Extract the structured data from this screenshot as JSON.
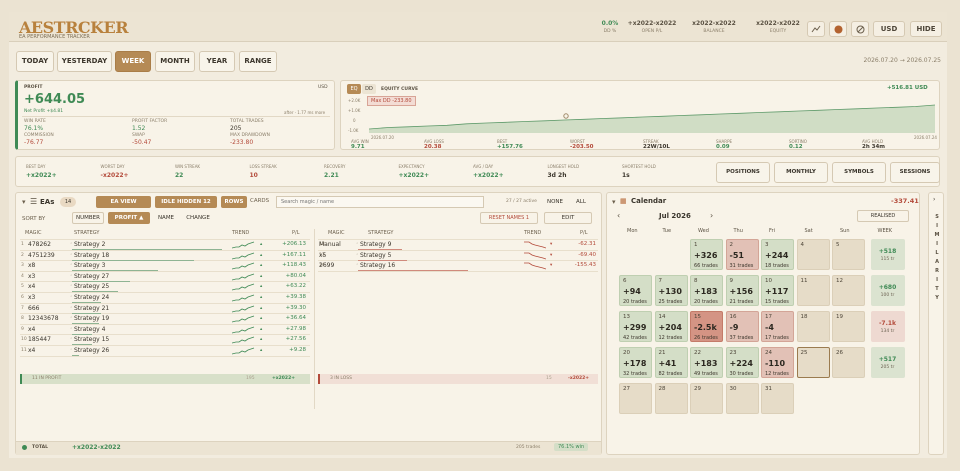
{
  "header": {
    "logo": "AESTRCKER",
    "subtitle": "EA PERFORMANCE TRACKER",
    "dd_pct": "0.0%",
    "dd_label": "DD %",
    "open_pl": "+x2022-x2022",
    "open_pl_label": "OPEN P/L",
    "balance": "x2022-x2022",
    "balance_label": "BALANCE",
    "equity": "x2022-x2022",
    "equity_label": "EQUITY",
    "currency_btn": "USD",
    "hide_btn": "HIDE"
  },
  "tabs": [
    "TODAY",
    "YESTERDAY",
    "WEEK",
    "MONTH",
    "YEAR",
    "RANGE"
  ],
  "active_tab": "WEEK",
  "date_range": "2026.07.20 → 2026.07.25",
  "profit_card": {
    "label": "PROFIT",
    "currency": "USD",
    "value": "+644.05",
    "net": "Net Profit +$4.81",
    "updated": "after · 1.77 ms more",
    "win_rate_label": "WIN RATE",
    "win_rate": "76.1%",
    "pf_label": "PROFIT FACTOR",
    "pf": "1.52",
    "trades_label": "TOTAL TRADES",
    "trades": "205",
    "comm_label": "COMMISSION",
    "comm": "-76.77",
    "swap_label": "SWAP",
    "swap": "-50.47",
    "mdd_label": "MAX DRAWDOWN",
    "mdd": "-233.80"
  },
  "equity": {
    "tab1": "EQ",
    "tab2": "DD",
    "title": "EQUITY CURVE",
    "maxdd": "Max DD -233.80",
    "total": "+516.81 USD",
    "y_ticks": [
      "+2.0K",
      "+1.0K",
      "0",
      "-1.0K"
    ],
    "x_start": "2026.07.20",
    "x_end": "2026.07.24",
    "curve": [
      0,
      2,
      3,
      4,
      5,
      7,
      8,
      9,
      10,
      11,
      12,
      13,
      14,
      15,
      16,
      17,
      18,
      19,
      20,
      21,
      22,
      23,
      24,
      25,
      26,
      27,
      28,
      29,
      30,
      32
    ],
    "metrics": [
      {
        "label": "AVG WIN",
        "value": "9.71",
        "color": "green"
      },
      {
        "label": "AVG LOSS",
        "value": "20.38",
        "color": "red"
      },
      {
        "label": "BEST",
        "value": "+157.76",
        "color": "green"
      },
      {
        "label": "WORST",
        "value": "-203.50",
        "color": "red"
      },
      {
        "label": "STREAK",
        "value": "22W/10L",
        "color": "dark"
      },
      {
        "label": "SHARPE",
        "value": "0.09",
        "color": "green"
      },
      {
        "label": "SORTINO",
        "value": "0.12",
        "color": "green"
      },
      {
        "label": "AVG HOLD",
        "value": "2h 34m",
        "color": "dark"
      }
    ]
  },
  "stats_row": [
    {
      "label": "BEST DAY",
      "value": "+x2022+",
      "color": "green"
    },
    {
      "label": "WORST DAY",
      "value": "-x2022+",
      "color": "red"
    },
    {
      "label": "WIN STREAK",
      "value": "22",
      "color": "green"
    },
    {
      "label": "LOSS STREAK",
      "value": "10",
      "color": "red"
    },
    {
      "label": "RECOVERY",
      "value": "2.21",
      "color": "green"
    },
    {
      "label": "EXPECTANCY",
      "value": "+x2022+",
      "color": "green"
    },
    {
      "label": "AVG / DAY",
      "value": "+x2022+",
      "color": "green"
    },
    {
      "label": "LONGEST HOLD",
      "value": "3d 2h",
      "color": "dark"
    },
    {
      "label": "SHORTEST HOLD",
      "value": "1s",
      "color": "dark"
    }
  ],
  "stats_buttons": [
    "POSITIONS",
    "MONTHLY",
    "SYMBOLS",
    "SESSIONS"
  ],
  "eas": {
    "title": "EAs",
    "count": "14",
    "btn_view": "EA VIEW",
    "btn_idle": "IDLE HIDDEN 12",
    "btn_rows": "ROWS",
    "btn_cards": "CARDS",
    "search_placeholder": "Search magic / name",
    "active": "27 / 27 active",
    "btn_none": "NONE",
    "btn_all": "ALL",
    "sort_label": "SORT BY",
    "sort": [
      "NUMBER",
      "PROFIT ▲",
      "NAME",
      "CHANGE"
    ],
    "reset_names": "RESET NAMES 1",
    "edit": "EDIT",
    "col_magic": "MAGIC",
    "col_strategy": "STRATEGY",
    "col_trend": "TREND",
    "col_pl": "P/L",
    "left_rows": [
      {
        "n": "1",
        "magic": "478262",
        "name": "Strategy 2",
        "pl": "+206.13"
      },
      {
        "n": "2",
        "magic": "4751239",
        "name": "Strategy 18",
        "pl": "+167.11"
      },
      {
        "n": "3",
        "magic": "x8",
        "name": "Strategy 3",
        "pl": "+118.43"
      },
      {
        "n": "4",
        "magic": "x3",
        "name": "Strategy 27",
        "pl": "+80.04"
      },
      {
        "n": "5",
        "magic": "x4",
        "name": "Strategy 25",
        "pl": "+63.22"
      },
      {
        "n": "6",
        "magic": "x3",
        "name": "Strategy 24",
        "pl": "+39.38"
      },
      {
        "n": "7",
        "magic": "666",
        "name": "Strategy 21",
        "pl": "+39.30"
      },
      {
        "n": "8",
        "magic": "12343678",
        "name": "Strategy 19",
        "pl": "+36.64"
      },
      {
        "n": "9",
        "magic": "x4",
        "name": "Strategy 4",
        "pl": "+27.98"
      },
      {
        "n": "10",
        "magic": "185447",
        "name": "Strategy 15",
        "pl": "+27.56"
      },
      {
        "n": "11",
        "magic": "x4",
        "name": "Strategy 26",
        "pl": "+9.28"
      }
    ],
    "right_rows": [
      {
        "n": "12",
        "magic": "Manual",
        "name": "Strategy 9",
        "pl": "-62.31"
      },
      {
        "n": "13",
        "magic": "x5",
        "name": "Strategy 5",
        "pl": "-69.40"
      },
      {
        "n": "14",
        "magic": "2699",
        "name": "Strategy 16",
        "pl": "-155.43"
      }
    ],
    "footer_left": "11 IN PROFIT",
    "footer_left_n": "195",
    "footer_left_v": "+x2022+",
    "footer_right": "3 IN LOSS",
    "footer_right_n": "15",
    "footer_right_v": "-x2022+",
    "total_label": "TOTAL",
    "total_v": "+x2022-x2022",
    "total_trades": "205 trades",
    "total_win": "76.1% win"
  },
  "calendar": {
    "title": "Calendar",
    "total": "-337.41",
    "month": "Jul 2026",
    "realised": "REALISED",
    "days": [
      "Mon",
      "Tue",
      "Wed",
      "Thu",
      "Fri",
      "Sat",
      "Sun"
    ],
    "week_label": "WEEK",
    "rows": [
      [
        {
          "d": ""
        },
        {
          "d": ""
        },
        {
          "d": "1",
          "p": "+326",
          "t": "66 trades",
          "c": "g"
        },
        {
          "d": "2",
          "p": "-51",
          "t": "31 trades",
          "c": "r"
        },
        {
          "d": "3",
          "p": "+244",
          "t": "18 trades",
          "c": "g"
        },
        {
          "d": "4"
        },
        {
          "d": "5"
        }
      ],
      [
        {
          "d": "6",
          "p": "+94",
          "t": "20 trades",
          "c": "g"
        },
        {
          "d": "7",
          "p": "+130",
          "t": "25 trades",
          "c": "g"
        },
        {
          "d": "8",
          "p": "+183",
          "t": "20 trades",
          "c": "g"
        },
        {
          "d": "9",
          "p": "+156",
          "t": "21 trades",
          "c": "g"
        },
        {
          "d": "10",
          "p": "+117",
          "t": "15 trades",
          "c": "g"
        },
        {
          "d": "11"
        },
        {
          "d": "12"
        }
      ],
      [
        {
          "d": "13",
          "p": "+299",
          "t": "42 trades",
          "c": "g"
        },
        {
          "d": "14",
          "p": "+204",
          "t": "12 trades",
          "c": "g"
        },
        {
          "d": "15",
          "p": "-2.5k",
          "t": "26 trades",
          "c": "rr"
        },
        {
          "d": "16",
          "p": "-9",
          "t": "37 trades",
          "c": "r"
        },
        {
          "d": "17",
          "p": "-4",
          "t": "17 trades",
          "c": "r"
        },
        {
          "d": "18"
        },
        {
          "d": "19"
        }
      ],
      [
        {
          "d": "20",
          "p": "+178",
          "t": "32 trades",
          "c": "g"
        },
        {
          "d": "21",
          "p": "+41",
          "t": "82 trades",
          "c": "g"
        },
        {
          "d": "22",
          "p": "+183",
          "t": "49 trades",
          "c": "g"
        },
        {
          "d": "23",
          "p": "+224",
          "t": "30 trades",
          "c": "g"
        },
        {
          "d": "24",
          "p": "-110",
          "t": "12 trades",
          "c": "r"
        },
        {
          "d": "25",
          "c": "sel"
        },
        {
          "d": "26"
        }
      ],
      [
        {
          "d": "27"
        },
        {
          "d": "28"
        },
        {
          "d": "29"
        },
        {
          "d": "30"
        },
        {
          "d": "31"
        },
        {
          "d": ""
        },
        {
          "d": ""
        }
      ]
    ],
    "weeks": [
      {
        "p": "+518",
        "t": "115 tr",
        "c": "g"
      },
      {
        "p": "+680",
        "t": "100 tr",
        "c": "g"
      },
      {
        "p": "-7.1k",
        "t": "134 tr",
        "c": "r"
      },
      {
        "p": "+517",
        "t": "205 tr",
        "c": "g"
      },
      {
        "p": "",
        "t": "",
        "c": ""
      }
    ]
  },
  "side_label": "SIMILARITY"
}
